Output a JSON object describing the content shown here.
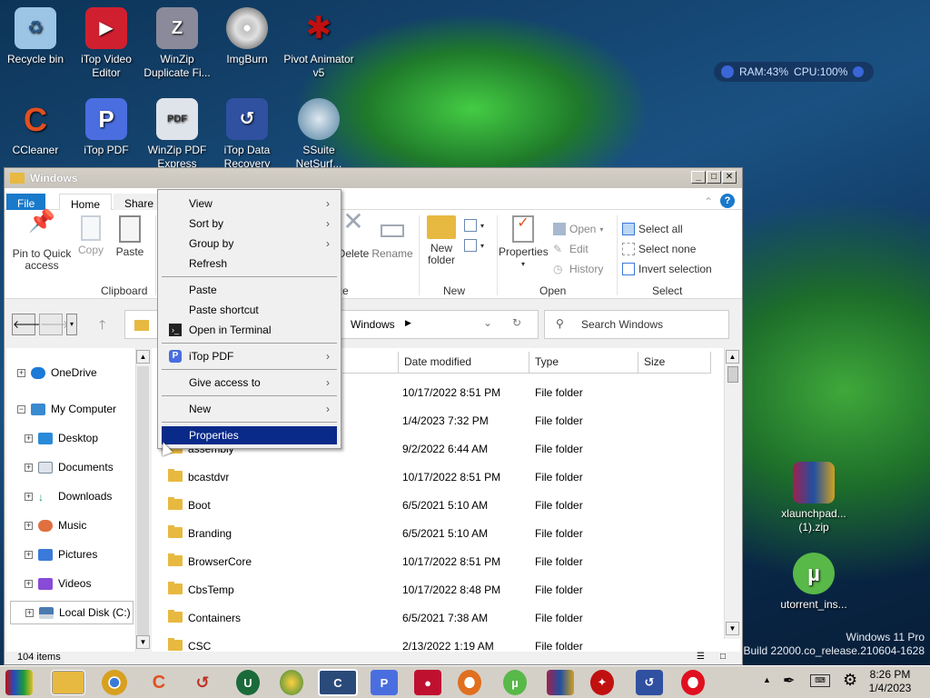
{
  "desktop": {
    "icons": [
      {
        "label": "Recycle bin",
        "icon": "recycle-bin-icon",
        "color": "#8fb8d8"
      },
      {
        "label": "iTop Video Editor",
        "icon": "itop-video-editor-icon",
        "color": "#d02030"
      },
      {
        "label": "WinZip Duplicate Fi...",
        "icon": "winzip-icon",
        "color": "#8a8a9a"
      },
      {
        "label": "ImgBurn",
        "icon": "imgburn-icon",
        "color": "#b0b0b0"
      },
      {
        "label": "Pivot Animator v5",
        "icon": "pivot-animator-icon",
        "color": "#c01010"
      },
      {
        "label": "CCleaner",
        "icon": "ccleaner-icon",
        "color": "#e05020"
      },
      {
        "label": "iTop PDF",
        "icon": "itop-pdf-icon",
        "color": "#4a6ee0"
      },
      {
        "label": "WinZip PDF Express",
        "icon": "winzip-pdf-icon",
        "color": "#7a8ab0"
      },
      {
        "label": "iTop Data Recovery",
        "icon": "itop-data-recovery-icon",
        "color": "#3050a0"
      },
      {
        "label": "SSuite NetSurf...",
        "icon": "ssuite-netsurf-icon",
        "color": "#5080a0"
      },
      {
        "label": "xlaunchpad... (1).zip",
        "icon": "winrar-icon",
        "color": "#a02050"
      },
      {
        "label": "utorrent_ins...",
        "icon": "utorrent-icon",
        "color": "#58b848"
      }
    ],
    "sysmon": {
      "ram": "RAM:43%",
      "cpu": "CPU:100%"
    },
    "watermark": {
      "line1": "Windows 11 Pro",
      "line2": "Build 22000.co_release.210604-1628"
    }
  },
  "window": {
    "title": "Windows",
    "tabs": {
      "file": "File",
      "home": "Home",
      "share": "Share"
    },
    "ribbon": {
      "pin": "Pin to Quick access",
      "copy": "Copy",
      "paste": "Paste",
      "clipboard": "Clipboard",
      "delete": "Delete",
      "rename": "Rename",
      "organize": "Organize",
      "new_folder": "New folder",
      "new": "New",
      "properties": "Properties",
      "open": "Open",
      "edit": "Edit",
      "history": "History",
      "open_group": "Open",
      "select_all": "Select all",
      "select_none": "Select none",
      "invert": "Invert selection",
      "select": "Select"
    },
    "address": {
      "path": "Windows",
      "search_placeholder": "Search Windows"
    },
    "nav": [
      {
        "label": "OneDrive",
        "color": "#1c7ad8"
      },
      {
        "label": "My Computer",
        "color": "#3a8ad0"
      },
      {
        "label": "Desktop",
        "color": "#2a8ad8"
      },
      {
        "label": "Documents",
        "color": "#7a8a9a"
      },
      {
        "label": "Downloads",
        "color": "#1a9a5a"
      },
      {
        "label": "Music",
        "color": "#e07040"
      },
      {
        "label": "Pictures",
        "color": "#3a7ad8"
      },
      {
        "label": "Videos",
        "color": "#8a4ad8"
      },
      {
        "label": "Local Disk (C:)",
        "color": "#4a7ab0"
      }
    ],
    "columns": {
      "date": "Date modified",
      "type": "Type",
      "size": "Size"
    },
    "rows": [
      {
        "name": "",
        "date": "10/17/2022 8:51 PM",
        "type": "File folder"
      },
      {
        "name": "",
        "date": "1/4/2023 7:32 PM",
        "type": "File folder"
      },
      {
        "name": "assembly",
        "date": "9/2/2022 6:44 AM",
        "type": "File folder"
      },
      {
        "name": "bcastdvr",
        "date": "10/17/2022 8:51 PM",
        "type": "File folder"
      },
      {
        "name": "Boot",
        "date": "6/5/2021 5:10 AM",
        "type": "File folder"
      },
      {
        "name": "Branding",
        "date": "6/5/2021 5:10 AM",
        "type": "File folder"
      },
      {
        "name": "BrowserCore",
        "date": "10/17/2022 8:51 PM",
        "type": "File folder"
      },
      {
        "name": "CbsTemp",
        "date": "10/17/2022 8:48 PM",
        "type": "File folder"
      },
      {
        "name": "Containers",
        "date": "6/5/2021 7:38 AM",
        "type": "File folder"
      },
      {
        "name": "CSC",
        "date": "2/13/2022 1:19 AM",
        "type": "File folder"
      }
    ],
    "status": "104 items"
  },
  "context_menu": {
    "view": "View",
    "sort_by": "Sort by",
    "group_by": "Group by",
    "refresh": "Refresh",
    "paste": "Paste",
    "paste_shortcut": "Paste shortcut",
    "open_terminal": "Open in Terminal",
    "itop_pdf": "iTop PDF",
    "give_access": "Give access to",
    "new": "New",
    "properties": "Properties"
  },
  "taskbar": {
    "apps": [
      {
        "icon": "start-icon",
        "color": "#222"
      },
      {
        "icon": "file-explorer-icon",
        "color": "#e8b940"
      },
      {
        "icon": "chrome-icon",
        "color": "#d8a020"
      },
      {
        "icon": "ccleaner-icon",
        "color": "#e05020"
      },
      {
        "icon": "reimage-icon",
        "color": "#c03020"
      },
      {
        "icon": "iobit-uninstaller-icon",
        "color": "#1a6a3a"
      },
      {
        "icon": "globe-browser-icon",
        "color": "#3a8a3a"
      },
      {
        "icon": "cclean-active-icon",
        "color": "#1a3a6a"
      },
      {
        "icon": "itop-pdf-icon",
        "color": "#4a6ee0"
      },
      {
        "icon": "itop-screen-recorder-icon",
        "color": "#c01030"
      },
      {
        "icon": "vpn-shield-icon",
        "color": "#e07020"
      },
      {
        "icon": "utorrent-icon",
        "color": "#58b848"
      },
      {
        "icon": "winrar-icon",
        "color": "#a02050"
      },
      {
        "icon": "game-icon",
        "color": "#c01010"
      },
      {
        "icon": "itop-data-recovery-icon",
        "color": "#3050a0"
      },
      {
        "icon": "opera-icon",
        "color": "#e01020"
      }
    ],
    "time": "8:26 PM",
    "date": "1/4/2023"
  }
}
